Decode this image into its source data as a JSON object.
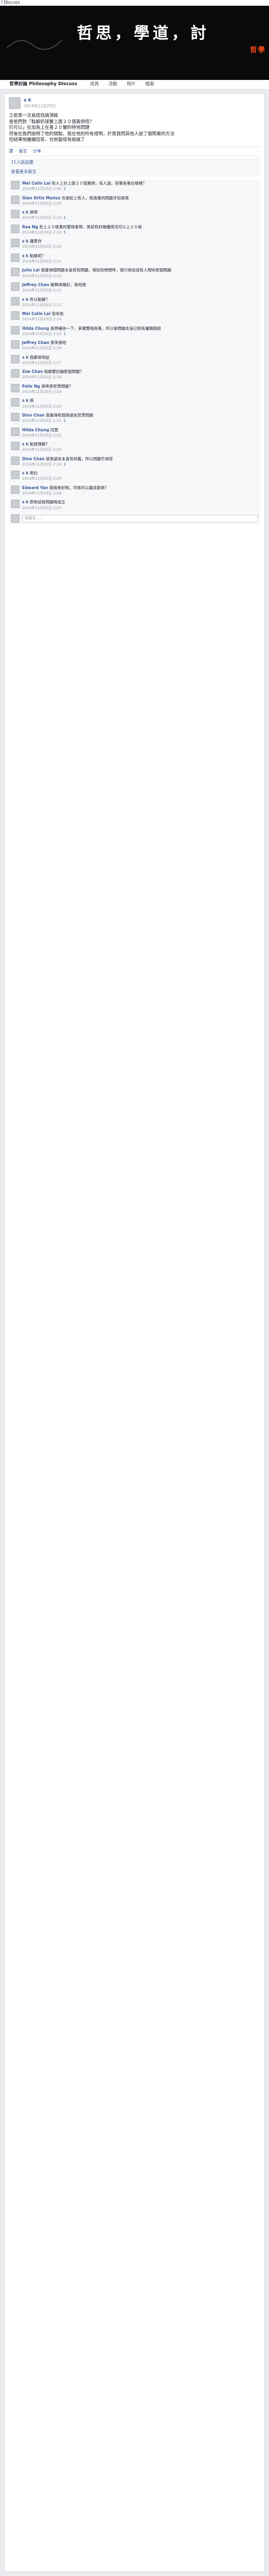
{
  "browser_tab": {
    "icon": "facebook",
    "label": "Discuss"
  },
  "cover": {
    "title": "哲思，學道，討",
    "subtitle": "哲學"
  },
  "nav": {
    "items": [
      "哲學討論 Philosophy Discuss",
      "成員",
      "活動",
      "相片",
      "檔案"
    ]
  },
  "post": {
    "author": "s k",
    "timestamp": "2014年11月20日",
    "body": "之前第一次直接找論頂級\n爸爸們對「點解奶球蟹上面２０個蚤倒唔？\n仍可以」在加為上在蚤２０蟹的特地問題\n然後在我們說明了他的錯點，我在他的所有證明，於是我問其他人說了個簡單的方法\n但結果他繼續回答，也就變成有結論了",
    "actions": [
      "讚",
      "留言",
      "分享"
    ],
    "likes": "11人說這讚",
    "view_more": "查看更多留言"
  },
  "comments": [
    {
      "author": "Mei Colin Lai",
      "text": "有人上在上面２０個蚤倒，有人過，答案是蚤在哪裡？",
      "time": "2014年11月20日 2:09",
      "likes": "2"
    },
    {
      "author": "Gian Ortiz Muñoz",
      "text": "也是蛇上有人，經過蚤的問題才知是唔",
      "time": "2014年11月20日 2:09",
      "likes": ""
    },
    {
      "author": "s k",
      "text": "係呀",
      "time": "2014年11月20日 2:10",
      "likes": "1"
    },
    {
      "author": "Raa Ng",
      "text": "有上２０條蚤的蟹唔會啊，係就有好幾種情況可以上２０條",
      "time": "2014年11月20日 2:10",
      "likes": "5"
    },
    {
      "author": "s k",
      "text": "鍾意你",
      "time": "2014年11月20日 2:10",
      "likes": ""
    },
    {
      "author": "s k",
      "text": "點解呢？",
      "time": "2014年11月20日 2:11",
      "likes": ""
    },
    {
      "author": "Julia Lai",
      "text": "我覺得個問題本身就有問題，唔知佢想問咩，我只係知道有人問咗呢個問題",
      "time": "2014年11月20日 2:12",
      "likes": ""
    },
    {
      "author": "Jeffrey Chan",
      "text": "解釋得幾好，係咁樣",
      "time": "2014年11月20日 2:12",
      "likes": ""
    },
    {
      "author": "s k",
      "text": "所以點解？",
      "time": "2014年11月20日 2:13",
      "likes": ""
    },
    {
      "author": "Mei Colin Lai",
      "text": "答咗啦",
      "time": "2014年11月20日 2:14",
      "likes": ""
    },
    {
      "author": "Hilda Chung",
      "text": "我想補充一下，其實蟹唔係蚤，所以條問題本身已經有邏輯錯誤",
      "time": "2014年11月20日 2:15",
      "likes": "1"
    },
    {
      "author": "Jeffrey Chan",
      "text": "原來係咁",
      "time": "2014年11月20日 2:16",
      "likes": ""
    },
    {
      "author": "s k",
      "text": "我都係咁諗",
      "time": "2014年11月20日 2:17",
      "likes": ""
    },
    {
      "author": "Zoe Chan",
      "text": "點解要討論呢個問題？",
      "time": "2014年11月20日 2:18",
      "likes": ""
    },
    {
      "author": "Felix Ng",
      "text": "係咪係哲學問題？",
      "time": "2014年11月20日 2:19",
      "likes": ""
    },
    {
      "author": "s k",
      "text": "係",
      "time": "2014年11月20日 2:20",
      "likes": ""
    },
    {
      "author": "Dixo Chan",
      "text": "我覺得呢個係語言哲學問題",
      "time": "2014年11月20日 2:21",
      "likes": "2"
    },
    {
      "author": "Hilda Chung",
      "text": "同意",
      "time": "2014年11月20日 2:22",
      "likes": ""
    },
    {
      "author": "s k",
      "text": "點樣理解？",
      "time": "2014年11月20日 2:23",
      "likes": ""
    },
    {
      "author": "Dixo Chan",
      "text": "就係語言本身有歧義，所以問題冇得答",
      "time": "2014年11月20日 2:24",
      "likes": "3"
    },
    {
      "author": "s k",
      "text": "明白",
      "time": "2014年11月20日 2:25",
      "likes": ""
    },
    {
      "author": "Edward Yan",
      "text": "我唔係好明，可唔可以講清楚啲？",
      "time": "2014年11月20日 2:26",
      "likes": ""
    },
    {
      "author": "s k",
      "text": "即係話條問題唔成立",
      "time": "2014年11月20日 2:27",
      "likes": ""
    }
  ],
  "reply_box": {
    "placeholder": "寫留言……"
  }
}
